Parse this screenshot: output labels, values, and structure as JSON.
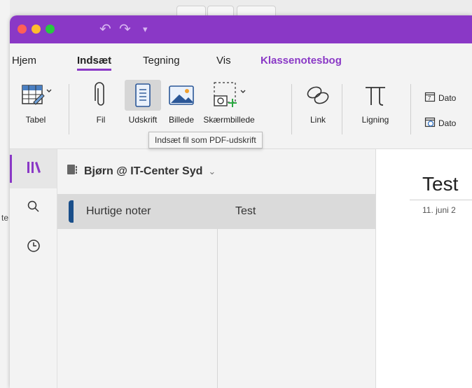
{
  "titlebar": {
    "icons": [
      "close-light",
      "minimize-light",
      "zoom-light",
      "undo-icon",
      "redo-icon",
      "customize-icon"
    ],
    "colors": {
      "bar": "#8a38c6",
      "close": "#ff5f57",
      "minimize": "#febc2e",
      "zoom": "#28c840"
    }
  },
  "tabs": [
    {
      "label": "Hjem"
    },
    {
      "label": "Indsæt"
    },
    {
      "label": "Tegning"
    },
    {
      "label": "Vis"
    },
    {
      "label": "Klassenotesbog"
    }
  ],
  "active_tab": "Indsæt",
  "ribbon": {
    "table": "Tabel",
    "file": "Fil",
    "printout": "Udskrift",
    "picture": "Billede",
    "screenshot": "Skærmbillede",
    "link": "Link",
    "equation": "Ligning",
    "date1": "Dato",
    "date2": "Dato"
  },
  "tooltip": "Indsæt fil som PDF-udskrift",
  "notebook": {
    "name": "Bjørn @ IT-Center Syd",
    "chevron": "⌄"
  },
  "sections": [
    {
      "label": "Hurtige noter",
      "color": "#1a4f8a"
    }
  ],
  "pages": [
    {
      "label": "Test"
    }
  ],
  "page": {
    "title": "Test",
    "date": "11. juni 2"
  },
  "rail": {
    "icons": [
      "notebooks-icon",
      "search-icon",
      "recent-icon"
    ]
  }
}
